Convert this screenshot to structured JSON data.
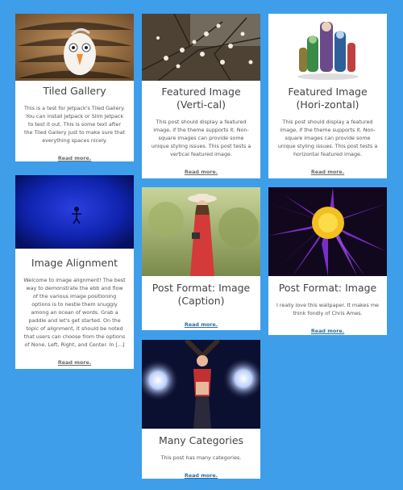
{
  "posts": [
    {
      "title": "Tiled Gallery",
      "excerpt": "This is a test for Jetpack's Tiled Gallery. You can install Jetpack or Slim Jetpack to test it out. This is some text after the Tiled Gallery just to make sure that everything spaces nicely.",
      "more": "Read more.",
      "image": "owl-toy-photo"
    },
    {
      "title": "Featured Image (Verti-cal)",
      "excerpt": "This post should display a featured image, if the theme supports it. Non-square images can provide some unique styling issues. This post tests a vertical featured image.",
      "more": "Read more.",
      "image": "blossom-branches-photo"
    },
    {
      "title": "Featured Image (Hori-zontal)",
      "excerpt": "This post should display a featured image, if the theme supports it. Non-square images can provide some unique styling issues. This post tests a horizontal featured image.",
      "more": "Read more.",
      "image": "cartoon-monsters-photo"
    },
    {
      "title": "Image Alignment",
      "excerpt": "Welcome to image alignment! The best way to demonstrate the ebb and flow of the various image positioning options is to nestle them snuggly among an ocean of words. Grab a paddle and let's get started. On the topic of alignment, it should be noted that users can choose from the options of None, Left, Right, and Center. In [...]",
      "more": "Read more.",
      "image": "blue-figure-photo"
    },
    {
      "title": "Post Format: Image (Caption)",
      "excerpt": "",
      "more": "Read more.",
      "image": "woman-camera-photo"
    },
    {
      "title": "Post Format: Image",
      "excerpt": "I really love this wallpaper. It makes me think fondly of Chris Ames.",
      "more": "Read more.",
      "image": "purple-flower-photo"
    },
    {
      "title": "Many Categories",
      "excerpt": "This post has many categories.",
      "more": "Read more.",
      "image": "dancer-lights-photo"
    }
  ],
  "colors": {
    "background": "#3f9ee9",
    "card": "#ffffff",
    "link_blue": "#2f6e9e",
    "link_gray": "#6b6b6b"
  }
}
